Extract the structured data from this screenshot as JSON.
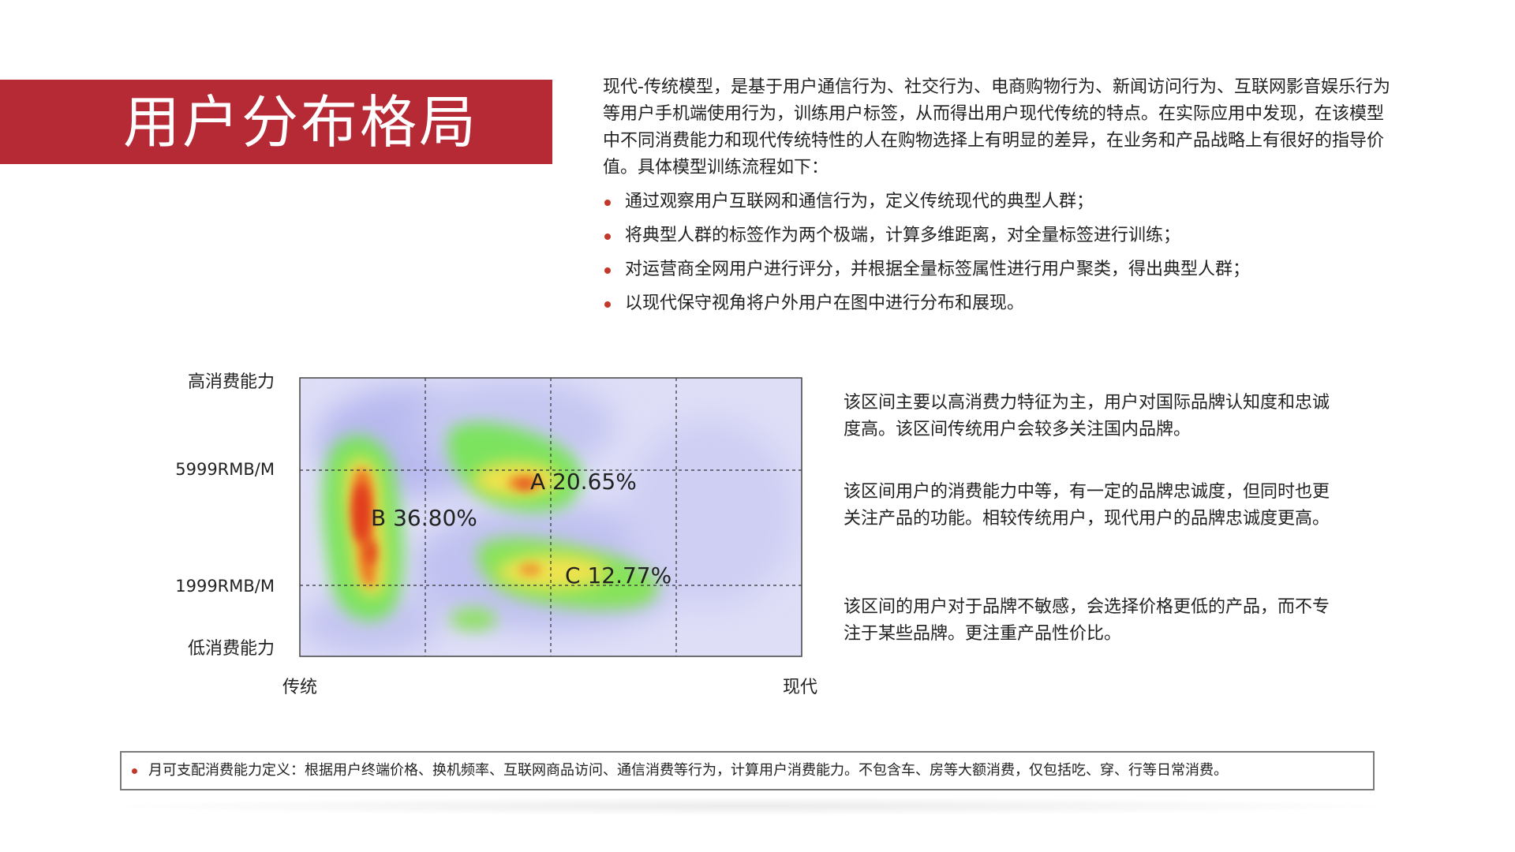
{
  "title": "用户分布格局",
  "intro": {
    "paragraph": "现代-传统模型，是基于用户通信行为、社交行为、电商购物行为、新闻访问行为、互联网影音娱乐行为等用户手机端使用行为，训练用户标签，从而得出用户现代传统的特点。在实际应用中发现，在该模型中不同消费能力和现代传统特性的人在购物选择上有明显的差异，在业务和产品战略上有很好的指导价值。具体模型训练流程如下：",
    "bullets": [
      "通过观察用户互联网和通信行为，定义传统现代的典型人群；",
      "将典型人群的标签作为两个极端，计算多维距离，对全量标签进行训练；",
      "对运营商全网用户进行评分，并根据全量标签属性进行用户聚类，得出典型人群；",
      "以现代保守视角将户外用户在图中进行分布和展现。"
    ]
  },
  "chart_data": {
    "type": "heatmap",
    "title": "",
    "xlabel_left": "传统",
    "xlabel_right": "现代",
    "y_tick_labels": [
      "高消费能力",
      "5999RMB/M",
      "1999RMB/M",
      "低消费能力"
    ],
    "grid": "dashed 4x3",
    "clusters": [
      {
        "label": "A",
        "value_text": "20.65%",
        "value": 20.65,
        "consumption": "5999RMB/M 以上",
        "orientation": "中间偏现代"
      },
      {
        "label": "B",
        "value_text": "36.80%",
        "value": 36.8,
        "consumption": "1999–5999RMB/M",
        "orientation": "传统"
      },
      {
        "label": "C",
        "value_text": "12.77%",
        "value": 12.77,
        "consumption": "1999RMB/M 附近",
        "orientation": "中间偏现代"
      }
    ],
    "colors": {
      "background": "#dcdcf6",
      "low": "#b7b8ee",
      "mid": "#6ee06a",
      "high": "#f0e648",
      "peak": "#e03a1a"
    }
  },
  "descriptions": [
    "该区间主要以高消费力特征为主，用户对国际品牌认知度和忠诚度高。该区间传统用户会较多关注国内品牌。",
    "该区间用户的消费能力中等，有一定的品牌忠诚度，但同时也更关注产品的功能。相较传统用户，现代用户的品牌忠诚度更高。",
    "该区间的用户对于品牌不敏感，会选择价格更低的产品，而不专注于某些品牌。更注重产品性价比。"
  ],
  "footnote": "月可支配消费能力定义：根据用户终端价格、换机频率、互联网商品访问、通信消费等行为，计算用户消费能力。不包含车、房等大额消费，仅包括吃、穿、行等日常消费。"
}
